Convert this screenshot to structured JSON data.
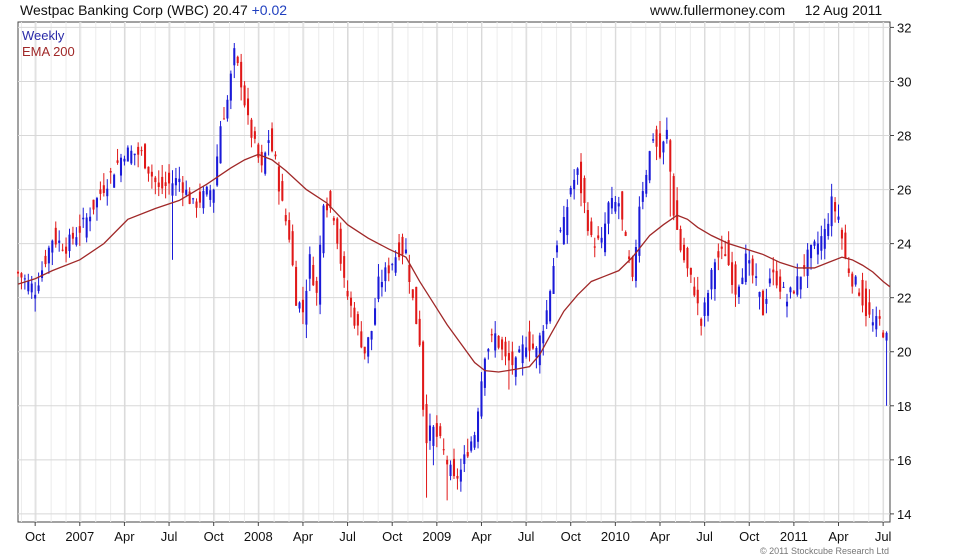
{
  "header": {
    "ticker": "Westpac Banking Corp (WBC) 20.47",
    "change": "+0.02",
    "site": "www.fullermoney.com",
    "date": "12 Aug 2011"
  },
  "footer": {
    "copyright": "© 2011 Stockcube Research Ltd"
  },
  "colors": {
    "up": "#1a1ad8",
    "down": "#e01818",
    "ema": "#a02828",
    "grid": "#d8d8d8"
  },
  "chart_data": {
    "type": "line",
    "grid": true,
    "y_axis": {
      "side": "right",
      "range": [
        13.7,
        32.2
      ],
      "ticks": [
        "14",
        "16",
        "18",
        "20",
        "22",
        "24",
        "26",
        "28",
        "30",
        "32"
      ]
    },
    "x_axis": {
      "range": [
        0,
        254
      ],
      "ticks": [
        {
          "label": "Oct",
          "w": 5
        },
        {
          "label": "2007",
          "w": 18
        },
        {
          "label": "Apr",
          "w": 31
        },
        {
          "label": "Jul",
          "w": 44
        },
        {
          "label": "Oct",
          "w": 57
        },
        {
          "label": "2008",
          "w": 70
        },
        {
          "label": "Apr",
          "w": 83
        },
        {
          "label": "Jul",
          "w": 96
        },
        {
          "label": "Oct",
          "w": 109
        },
        {
          "label": "2009",
          "w": 122
        },
        {
          "label": "Apr",
          "w": 135
        },
        {
          "label": "Jul",
          "w": 148
        },
        {
          "label": "Oct",
          "w": 161
        },
        {
          "label": "2010",
          "w": 174
        },
        {
          "label": "Apr",
          "w": 187
        },
        {
          "label": "Jul",
          "w": 200
        },
        {
          "label": "Oct",
          "w": 213
        },
        {
          "label": "2011",
          "w": 226
        },
        {
          "label": "Apr",
          "w": 239
        },
        {
          "label": "Jul",
          "w": 252
        }
      ]
    },
    "series": [
      {
        "name": "Weekly",
        "kind": "candlestick",
        "anchors": [
          [
            0,
            22.9
          ],
          [
            5,
            22.3
          ],
          [
            10,
            24.2
          ],
          [
            14,
            23.9
          ],
          [
            19,
            24.7
          ],
          [
            25,
            26.1
          ],
          [
            31,
            27.4
          ],
          [
            36,
            27.3
          ],
          [
            41,
            26.0
          ],
          [
            47,
            26.4
          ],
          [
            51,
            25.4
          ],
          [
            57,
            26.1
          ],
          [
            59,
            28.4
          ],
          [
            61,
            29.3
          ],
          [
            63,
            31.0
          ],
          [
            65,
            30.0
          ],
          [
            67,
            28.5
          ],
          [
            71,
            26.7
          ],
          [
            73,
            27.9
          ],
          [
            75,
            27.0
          ],
          [
            77,
            25.4
          ],
          [
            79,
            24.3
          ],
          [
            81,
            22.0
          ],
          [
            83,
            21.5
          ],
          [
            85,
            23.4
          ],
          [
            87,
            22.1
          ],
          [
            89,
            25.7
          ],
          [
            92,
            25.1
          ],
          [
            95,
            22.5
          ],
          [
            98,
            21.2
          ],
          [
            101,
            20.0
          ],
          [
            103,
            20.8
          ],
          [
            105,
            22.5
          ],
          [
            108,
            23.1
          ],
          [
            111,
            23.8
          ],
          [
            113,
            23.7
          ],
          [
            115,
            21.9
          ],
          [
            117,
            20.4
          ],
          [
            118,
            18.0
          ],
          [
            119,
            16.9
          ],
          [
            121,
            17.1
          ],
          [
            123,
            16.6
          ],
          [
            125,
            15.9
          ],
          [
            127,
            15.2
          ],
          [
            129,
            15.6
          ],
          [
            131,
            16.4
          ],
          [
            133,
            17.0
          ],
          [
            136,
            20.0
          ],
          [
            139,
            20.6
          ],
          [
            142,
            19.7
          ],
          [
            145,
            19.5
          ],
          [
            148,
            20.4
          ],
          [
            151,
            20.0
          ],
          [
            154,
            21.5
          ],
          [
            157,
            24.1
          ],
          [
            159,
            24.7
          ],
          [
            161,
            26.1
          ],
          [
            163,
            26.6
          ],
          [
            165,
            25.4
          ],
          [
            167,
            24.1
          ],
          [
            170,
            24.0
          ],
          [
            172,
            25.4
          ],
          [
            175,
            25.5
          ],
          [
            177,
            24.0
          ],
          [
            179,
            22.5
          ],
          [
            181,
            25.5
          ],
          [
            183,
            26.7
          ],
          [
            185,
            28.0
          ],
          [
            187,
            27.2
          ],
          [
            189,
            28.1
          ],
          [
            191,
            25.2
          ],
          [
            193,
            23.8
          ],
          [
            195,
            23.0
          ],
          [
            197,
            22.3
          ],
          [
            199,
            21.0
          ],
          [
            201,
            22.2
          ],
          [
            203,
            23.4
          ],
          [
            206,
            23.7
          ],
          [
            209,
            22.3
          ],
          [
            212,
            23.4
          ],
          [
            215,
            22.5
          ],
          [
            217,
            21.5
          ],
          [
            219,
            22.8
          ],
          [
            221,
            22.7
          ],
          [
            224,
            21.9
          ],
          [
            227,
            22.6
          ],
          [
            230,
            23.5
          ],
          [
            233,
            24.0
          ],
          [
            235,
            24.4
          ],
          [
            237,
            25.5
          ],
          [
            239,
            25.0
          ],
          [
            241,
            23.4
          ],
          [
            243,
            22.7
          ],
          [
            245,
            22.3
          ],
          [
            247,
            21.5
          ],
          [
            249,
            21.0
          ],
          [
            251,
            21.1
          ],
          [
            253,
            20.47
          ]
        ],
        "wicks": [
          [
            45,
            23.4
          ],
          [
            119,
            14.6
          ],
          [
            121,
            15.8
          ],
          [
            125,
            14.5
          ],
          [
            143,
            18.6
          ],
          [
            190,
            25.0
          ],
          [
            199,
            20.6
          ],
          [
            253,
            18.0
          ]
        ]
      },
      {
        "name": "EMA 200",
        "kind": "line",
        "points": [
          [
            0,
            22.5
          ],
          [
            5,
            22.7
          ],
          [
            10,
            23.0
          ],
          [
            18,
            23.4
          ],
          [
            25,
            24.0
          ],
          [
            32,
            24.9
          ],
          [
            40,
            25.3
          ],
          [
            47,
            25.6
          ],
          [
            55,
            26.2
          ],
          [
            62,
            26.8
          ],
          [
            66,
            27.1
          ],
          [
            70,
            27.3
          ],
          [
            74,
            27.1
          ],
          [
            78,
            26.7
          ],
          [
            84,
            26.0
          ],
          [
            90,
            25.5
          ],
          [
            96,
            24.7
          ],
          [
            102,
            24.2
          ],
          [
            108,
            23.8
          ],
          [
            113,
            23.5
          ],
          [
            117,
            22.6
          ],
          [
            121,
            21.8
          ],
          [
            125,
            21.0
          ],
          [
            129,
            20.3
          ],
          [
            133,
            19.6
          ],
          [
            136,
            19.3
          ],
          [
            140,
            19.25
          ],
          [
            145,
            19.35
          ],
          [
            149,
            19.45
          ],
          [
            152,
            19.9
          ],
          [
            155,
            20.6
          ],
          [
            159,
            21.5
          ],
          [
            163,
            22.1
          ],
          [
            167,
            22.6
          ],
          [
            171,
            22.8
          ],
          [
            175,
            23.0
          ],
          [
            179,
            23.5
          ],
          [
            184,
            24.3
          ],
          [
            188,
            24.7
          ],
          [
            192,
            25.05
          ],
          [
            195,
            24.9
          ],
          [
            198,
            24.6
          ],
          [
            202,
            24.3
          ],
          [
            207,
            24.0
          ],
          [
            212,
            23.8
          ],
          [
            217,
            23.6
          ],
          [
            222,
            23.3
          ],
          [
            227,
            23.1
          ],
          [
            232,
            23.1
          ],
          [
            236,
            23.3
          ],
          [
            240,
            23.5
          ],
          [
            243,
            23.4
          ],
          [
            246,
            23.2
          ],
          [
            249,
            22.95
          ],
          [
            252,
            22.6
          ],
          [
            254,
            22.4
          ]
        ]
      }
    ]
  }
}
